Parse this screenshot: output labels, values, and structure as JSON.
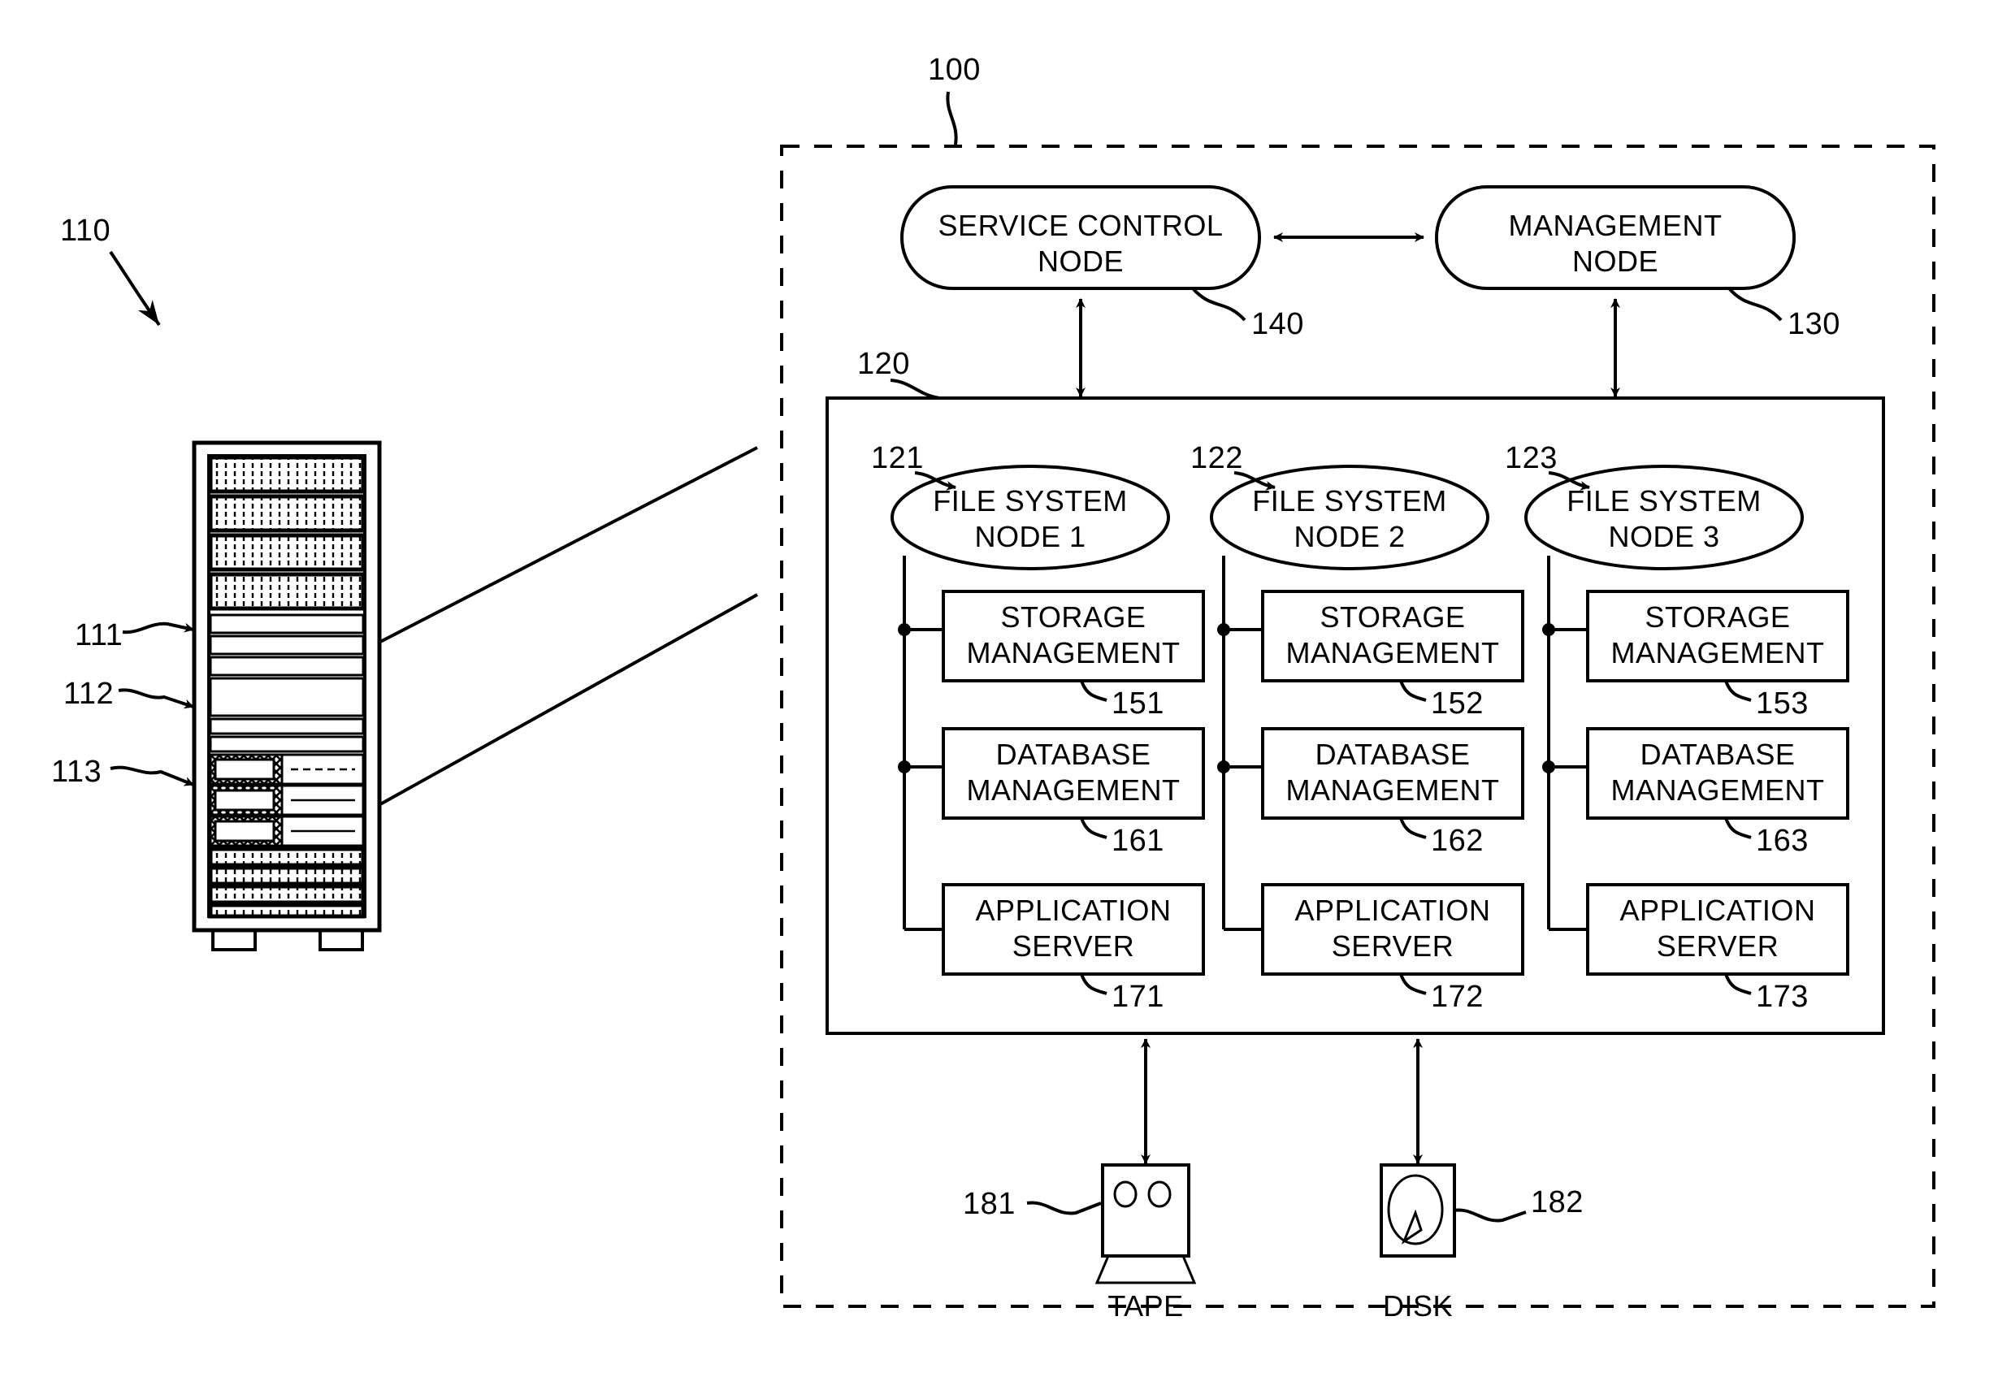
{
  "figure": {
    "title_ref": "100",
    "system_boundary_ref": "100",
    "rack": {
      "ref": "110",
      "part_refs": [
        "111",
        "112",
        "113"
      ]
    },
    "top_nodes": [
      {
        "id": "service-control-node",
        "label_line1": "SERVICE CONTROL",
        "label_line2": "NODE",
        "ref": "140"
      },
      {
        "id": "management-node",
        "label_line1": "MANAGEMENT",
        "label_line2": "NODE",
        "ref": "130"
      }
    ],
    "cluster": {
      "ref": "120",
      "columns": [
        {
          "node_ref": "121",
          "node_line1": "FILE SYSTEM",
          "node_line2": "NODE 1",
          "boxes": [
            {
              "line1": "STORAGE",
              "line2": "MANAGEMENT",
              "ref": "151"
            },
            {
              "line1": "DATABASE",
              "line2": "MANAGEMENT",
              "ref": "161"
            },
            {
              "line1": "APPLICATION",
              "line2": "SERVER",
              "ref": "171"
            }
          ]
        },
        {
          "node_ref": "122",
          "node_line1": "FILE SYSTEM",
          "node_line2": "NODE 2",
          "boxes": [
            {
              "line1": "STORAGE",
              "line2": "MANAGEMENT",
              "ref": "152"
            },
            {
              "line1": "DATABASE",
              "line2": "MANAGEMENT",
              "ref": "162"
            },
            {
              "line1": "APPLICATION",
              "line2": "SERVER",
              "ref": "172"
            }
          ]
        },
        {
          "node_ref": "123",
          "node_line1": "FILE SYSTEM",
          "node_line2": "NODE 3",
          "boxes": [
            {
              "line1": "STORAGE",
              "line2": "MANAGEMENT",
              "ref": "153"
            },
            {
              "line1": "DATABASE",
              "line2": "MANAGEMENT",
              "ref": "163"
            },
            {
              "line1": "APPLICATION",
              "line2": "SERVER",
              "ref": "173"
            }
          ]
        }
      ]
    },
    "storage_devices": [
      {
        "id": "tape-device",
        "label": "TAPE",
        "ref": "181"
      },
      {
        "id": "disk-device",
        "label": "DISK",
        "ref": "182"
      }
    ],
    "colors": {
      "line": "#000000",
      "background": "#ffffff"
    }
  }
}
